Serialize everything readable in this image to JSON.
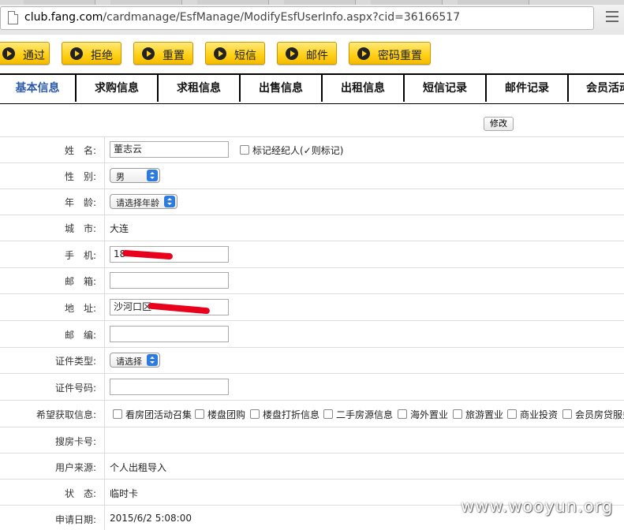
{
  "browser": {
    "url_host": "club.fang.com",
    "url_path": "/cardmanage/EsfManage/ModifyEsfUserInfo.aspx?cid=36166517"
  },
  "toolbar": {
    "buttons": [
      "通过",
      "拒绝",
      "重置",
      "短信",
      "邮件",
      "密码重置"
    ]
  },
  "tabs": [
    "基本信息",
    "求购信息",
    "求租信息",
    "出售信息",
    "出租信息",
    "短信记录",
    "邮件记录",
    "会员活动"
  ],
  "form": {
    "edit_button": "修改",
    "name_label": "姓　名:",
    "name_value": "董志云",
    "mark_agent_label": "标记经纪人(✓则标记)",
    "gender_label": "性　别:",
    "gender_value": "男",
    "age_label": "年　龄:",
    "age_value": "请选择年龄",
    "city_label": "城　市:",
    "city_value": "大连",
    "phone_label": "手　机:",
    "phone_value": "18",
    "email_label": "邮　箱:",
    "email_value": "",
    "address_label": "地　址:",
    "address_value": "沙河口区",
    "zip_label": "邮　编:",
    "zip_value": "",
    "id_type_label": "证件类型:",
    "id_type_value": "请选择",
    "id_number_label": "证件号码:",
    "id_number_value": "",
    "info_pref_label": "希望获取信息:",
    "info_options": [
      "看房团活动召集",
      "楼盘团购",
      "楼盘打折信息",
      "二手房源信息",
      "海外置业",
      "旅游置业",
      "商业投资",
      "会员房贷服务"
    ],
    "card_label": "搜房卡号:",
    "card_value": "",
    "source_label": "用户来源:",
    "source_value": "个人出租导入",
    "status_label": "状　态:",
    "status_value": "临时卡",
    "apply_date_label": "申请日期:",
    "apply_date_value": "2015/6/2 5:08:00"
  },
  "watermark": "www.wooyun.org"
}
